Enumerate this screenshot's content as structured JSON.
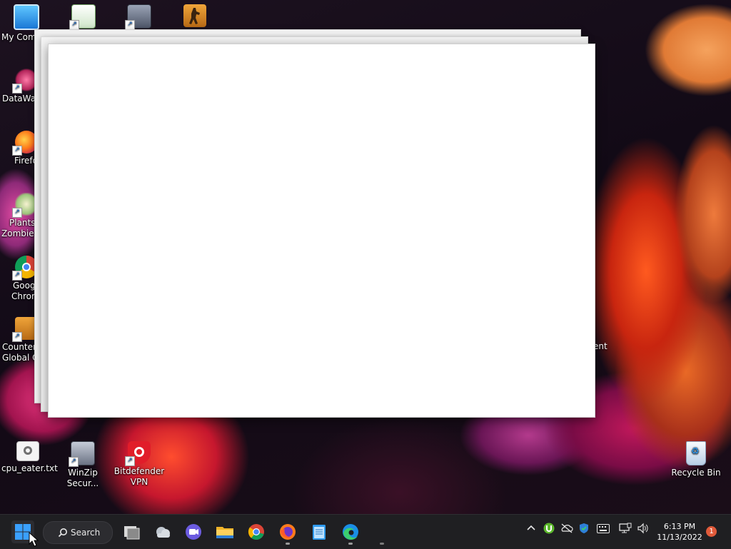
{
  "desktop": {
    "icons_left": [
      {
        "label": "My Com",
        "icon": "monitor-icon"
      },
      {
        "label": "DataWag",
        "icon": "datawag-icon"
      },
      {
        "label": "Firefo",
        "icon": "firefox-icon"
      },
      {
        "label": "Plants",
        "label2": "Zombies",
        "icon": "plants-zombies-icon"
      },
      {
        "label": "Goog",
        "label2": "Chrom",
        "icon": "chrome-icon"
      },
      {
        "label": "Counter-",
        "label2": "Global O",
        "icon": "counter-strike-icon"
      }
    ],
    "icons_top": [
      {
        "label": "",
        "icon": "text-editor-icon"
      },
      {
        "label": "",
        "icon": "archive-tool-icon"
      },
      {
        "label": "",
        "icon": "counter-strike-icon"
      }
    ],
    "icons_bottom": [
      {
        "label": "cpu_eater.txt",
        "icon": "settings-file-icon"
      },
      {
        "label": "WinZip",
        "label2": "Secur...",
        "icon": "winzip-icon"
      },
      {
        "label": "Bitdefender",
        "label2": "VPN",
        "icon": "bitdefender-vpn-icon"
      }
    ],
    "recycle_bin": {
      "label": "Recycle Bin",
      "icon": "recycle-bin-icon"
    },
    "partial_right_label": "ent"
  },
  "taskbar": {
    "start_icon": "windows-start-icon",
    "search_label": "Search",
    "apps": [
      {
        "name": "task-view",
        "icon": "task-view-icon"
      },
      {
        "name": "onedrive",
        "icon": "cloud-icon"
      },
      {
        "name": "teams-chat",
        "icon": "video-chat-icon"
      },
      {
        "name": "file-explorer",
        "icon": "folder-icon"
      },
      {
        "name": "chrome",
        "icon": "chrome-icon"
      },
      {
        "name": "firefox",
        "icon": "firefox-icon"
      },
      {
        "name": "notepad",
        "icon": "notepad-icon"
      },
      {
        "name": "edge",
        "icon": "edge-icon"
      }
    ],
    "tray": {
      "chevron_icon": "chevron-up-icon",
      "icons": [
        "utorrent-icon",
        "onedrive-offline-icon",
        "security-shield-icon",
        "keyboard-icon",
        "network-icon",
        "speaker-icon"
      ],
      "time": "6:13 PM",
      "date": "11/13/2022",
      "notification_count": "1"
    }
  },
  "colors": {
    "taskbar_bg": "#1f1f22",
    "accent_blue": "#3aa0ff",
    "badge": "#e05a3a"
  }
}
